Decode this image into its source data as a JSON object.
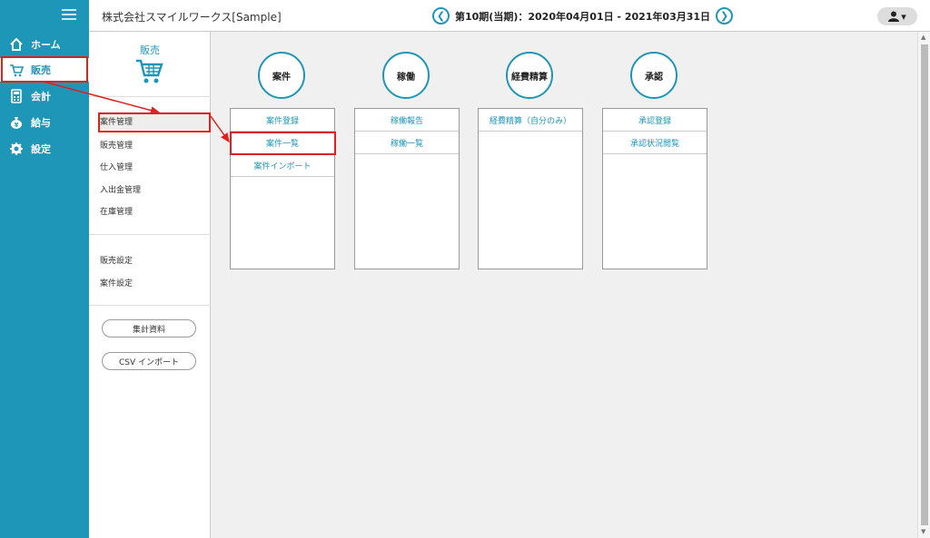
{
  "header": {
    "company": "株式会社スマイルワークス[Sample]",
    "period": "第10期(当期)：2020年04月01日 - 2021年03月31日",
    "prev_label": "❮",
    "next_label": "❯",
    "user_label": "▾"
  },
  "nav": {
    "items": [
      {
        "label": "ホーム",
        "icon": "home-icon"
      },
      {
        "label": "販売",
        "icon": "cart-icon"
      },
      {
        "label": "会計",
        "icon": "calculator-icon"
      },
      {
        "label": "給与",
        "icon": "money-bag-icon"
      },
      {
        "label": "設定",
        "icon": "gear-icon"
      }
    ]
  },
  "subnav": {
    "title": "販売",
    "group1": [
      "案件管理",
      "販売管理",
      "仕入管理",
      "入出金管理",
      "在庫管理"
    ],
    "group2": [
      "販売設定",
      "案件設定"
    ],
    "buttons": [
      "集計資料",
      "CSV インポート"
    ]
  },
  "columns": [
    {
      "title": "案件",
      "links": [
        "案件登録",
        "案件一覧",
        "案件インポート"
      ]
    },
    {
      "title": "稼働",
      "links": [
        "稼働報告",
        "稼働一覧"
      ]
    },
    {
      "title": "経費精算",
      "links": [
        "経費精算（自分のみ）"
      ]
    },
    {
      "title": "承認",
      "links": [
        "承認登録",
        "承認状況閲覧"
      ]
    }
  ],
  "colors": {
    "brand": "#1e96b7",
    "highlight": "#e0201f"
  }
}
